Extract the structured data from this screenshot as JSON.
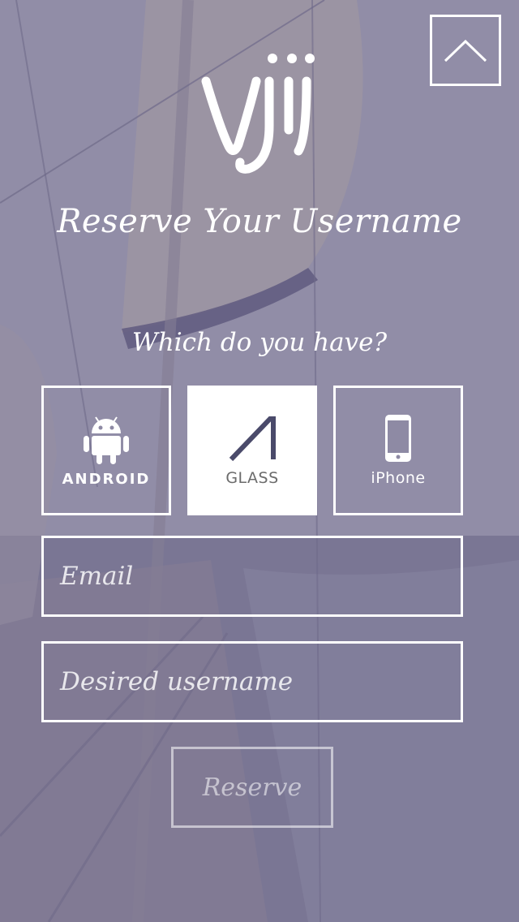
{
  "header": {
    "logo_text": "Viji",
    "title": "Reserve Your Username"
  },
  "question": "Which do you have?",
  "devices": [
    {
      "label": "ANDROID",
      "icon": "android-robot-icon",
      "selected": false
    },
    {
      "label": "GLASS",
      "icon": "glass-icon",
      "selected": true
    },
    {
      "label": "iPhone",
      "icon": "iphone-icon",
      "selected": false
    }
  ],
  "form": {
    "email_placeholder": "Email",
    "username_placeholder": "Desired username",
    "submit_label": "Reserve"
  },
  "colors": {
    "text": "#ffffff",
    "selected_tile": "#ffffff",
    "glass_icon": "#4a4a6a"
  }
}
